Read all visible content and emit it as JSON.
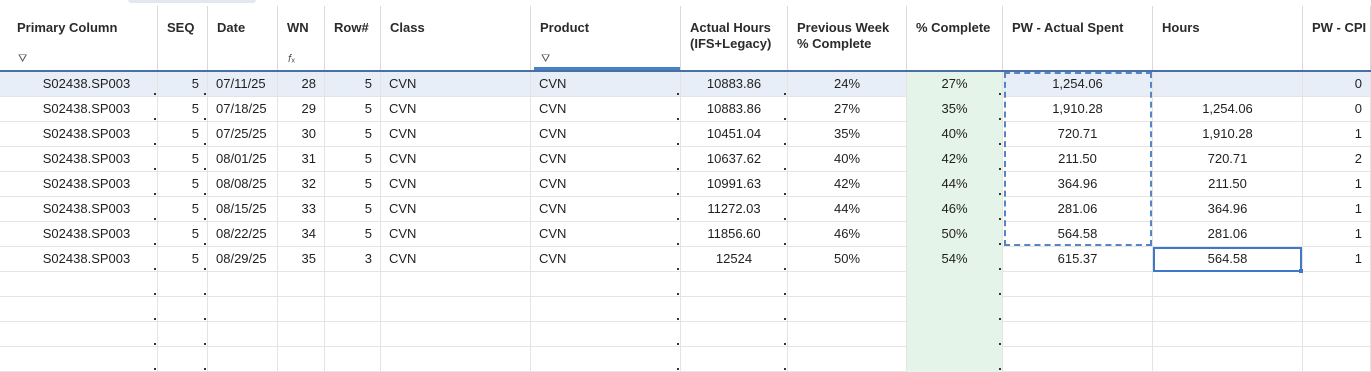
{
  "columns": [
    {
      "key": "primary",
      "label": "Primary Column",
      "icon": "filter-icon",
      "glyph": "⛛"
    },
    {
      "key": "seq",
      "label": "SEQ"
    },
    {
      "key": "date",
      "label": "Date"
    },
    {
      "key": "wn",
      "label": "WN",
      "icon": "formula-icon",
      "glyph": "𝑓ₓ"
    },
    {
      "key": "rownum",
      "label": "Row#"
    },
    {
      "key": "class",
      "label": "Class"
    },
    {
      "key": "product",
      "label": "Product",
      "icon": "filter-icon",
      "glyph": "⛛"
    },
    {
      "key": "actual",
      "label": "Actual Hours\n(IFS+Legacy)"
    },
    {
      "key": "prev",
      "label": "Previous Week\n% Complete"
    },
    {
      "key": "pct",
      "label": "% Complete"
    },
    {
      "key": "pw_spent",
      "label": "PW - Actual Spent"
    },
    {
      "key": "hours",
      "label": "Hours"
    },
    {
      "key": "pw_cpi",
      "label": "PW - CPI"
    }
  ],
  "rows": [
    {
      "primary": "S02438.SP003",
      "seq": "5",
      "date": "07/11/25",
      "wn": "28",
      "rownum": "5",
      "class": "CVN",
      "product": "CVN",
      "actual": "10883.86",
      "prev": "24%",
      "pct": "27%",
      "pw_spent": "1,254.06",
      "hours": "",
      "pw_cpi": "0"
    },
    {
      "primary": "S02438.SP003",
      "seq": "5",
      "date": "07/18/25",
      "wn": "29",
      "rownum": "5",
      "class": "CVN",
      "product": "CVN",
      "actual": "10883.86",
      "prev": "27%",
      "pct": "35%",
      "pw_spent": "1,910.28",
      "hours": "1,254.06",
      "pw_cpi": "0"
    },
    {
      "primary": "S02438.SP003",
      "seq": "5",
      "date": "07/25/25",
      "wn": "30",
      "rownum": "5",
      "class": "CVN",
      "product": "CVN",
      "actual": "10451.04",
      "prev": "35%",
      "pct": "40%",
      "pw_spent": "720.71",
      "hours": "1,910.28",
      "pw_cpi": "1"
    },
    {
      "primary": "S02438.SP003",
      "seq": "5",
      "date": "08/01/25",
      "wn": "31",
      "rownum": "5",
      "class": "CVN",
      "product": "CVN",
      "actual": "10637.62",
      "prev": "40%",
      "pct": "42%",
      "pw_spent": "211.50",
      "hours": "720.71",
      "pw_cpi": "2"
    },
    {
      "primary": "S02438.SP003",
      "seq": "5",
      "date": "08/08/25",
      "wn": "32",
      "rownum": "5",
      "class": "CVN",
      "product": "CVN",
      "actual": "10991.63",
      "prev": "42%",
      "pct": "44%",
      "pw_spent": "364.96",
      "hours": "211.50",
      "pw_cpi": "1"
    },
    {
      "primary": "S02438.SP003",
      "seq": "5",
      "date": "08/15/25",
      "wn": "33",
      "rownum": "5",
      "class": "CVN",
      "product": "CVN",
      "actual": "11272.03",
      "prev": "44%",
      "pct": "46%",
      "pw_spent": "281.06",
      "hours": "364.96",
      "pw_cpi": "1"
    },
    {
      "primary": "S02438.SP003",
      "seq": "5",
      "date": "08/22/25",
      "wn": "34",
      "rownum": "5",
      "class": "CVN",
      "product": "CVN",
      "actual": "11856.60",
      "prev": "46%",
      "pct": "50%",
      "pw_spent": "564.58",
      "hours": "281.06",
      "pw_cpi": "1"
    },
    {
      "primary": "S02438.SP003",
      "seq": "5",
      "date": "08/29/25",
      "wn": "35",
      "rownum": "3",
      "class": "CVN",
      "product": "CVN",
      "actual": "12524",
      "prev": "50%",
      "pct": "54%",
      "pw_spent": "615.37",
      "hours": "564.58",
      "pw_cpi": "1"
    },
    {
      "primary": "",
      "seq": "",
      "date": "",
      "wn": "",
      "rownum": "",
      "class": "",
      "product": "",
      "actual": "",
      "prev": "",
      "pct": "",
      "pw_spent": "",
      "hours": "",
      "pw_cpi": ""
    },
    {
      "primary": "",
      "seq": "",
      "date": "",
      "wn": "",
      "rownum": "",
      "class": "",
      "product": "",
      "actual": "",
      "prev": "",
      "pct": "",
      "pw_spent": "",
      "hours": "",
      "pw_cpi": ""
    },
    {
      "primary": "",
      "seq": "",
      "date": "",
      "wn": "",
      "rownum": "",
      "class": "",
      "product": "",
      "actual": "",
      "prev": "",
      "pct": "",
      "pw_spent": "",
      "hours": "",
      "pw_cpi": ""
    },
    {
      "primary": "",
      "seq": "",
      "date": "",
      "wn": "",
      "rownum": "",
      "class": "",
      "product": "",
      "actual": "",
      "prev": "",
      "pct": "",
      "pw_spent": "",
      "hours": "",
      "pw_cpi": ""
    }
  ],
  "colors": {
    "header_rule": "#4a6fa5",
    "percent_complete_bg": "#e5f4e8",
    "selected_row_bg": "#e8eef8",
    "selection_blue": "#3e78c8"
  }
}
